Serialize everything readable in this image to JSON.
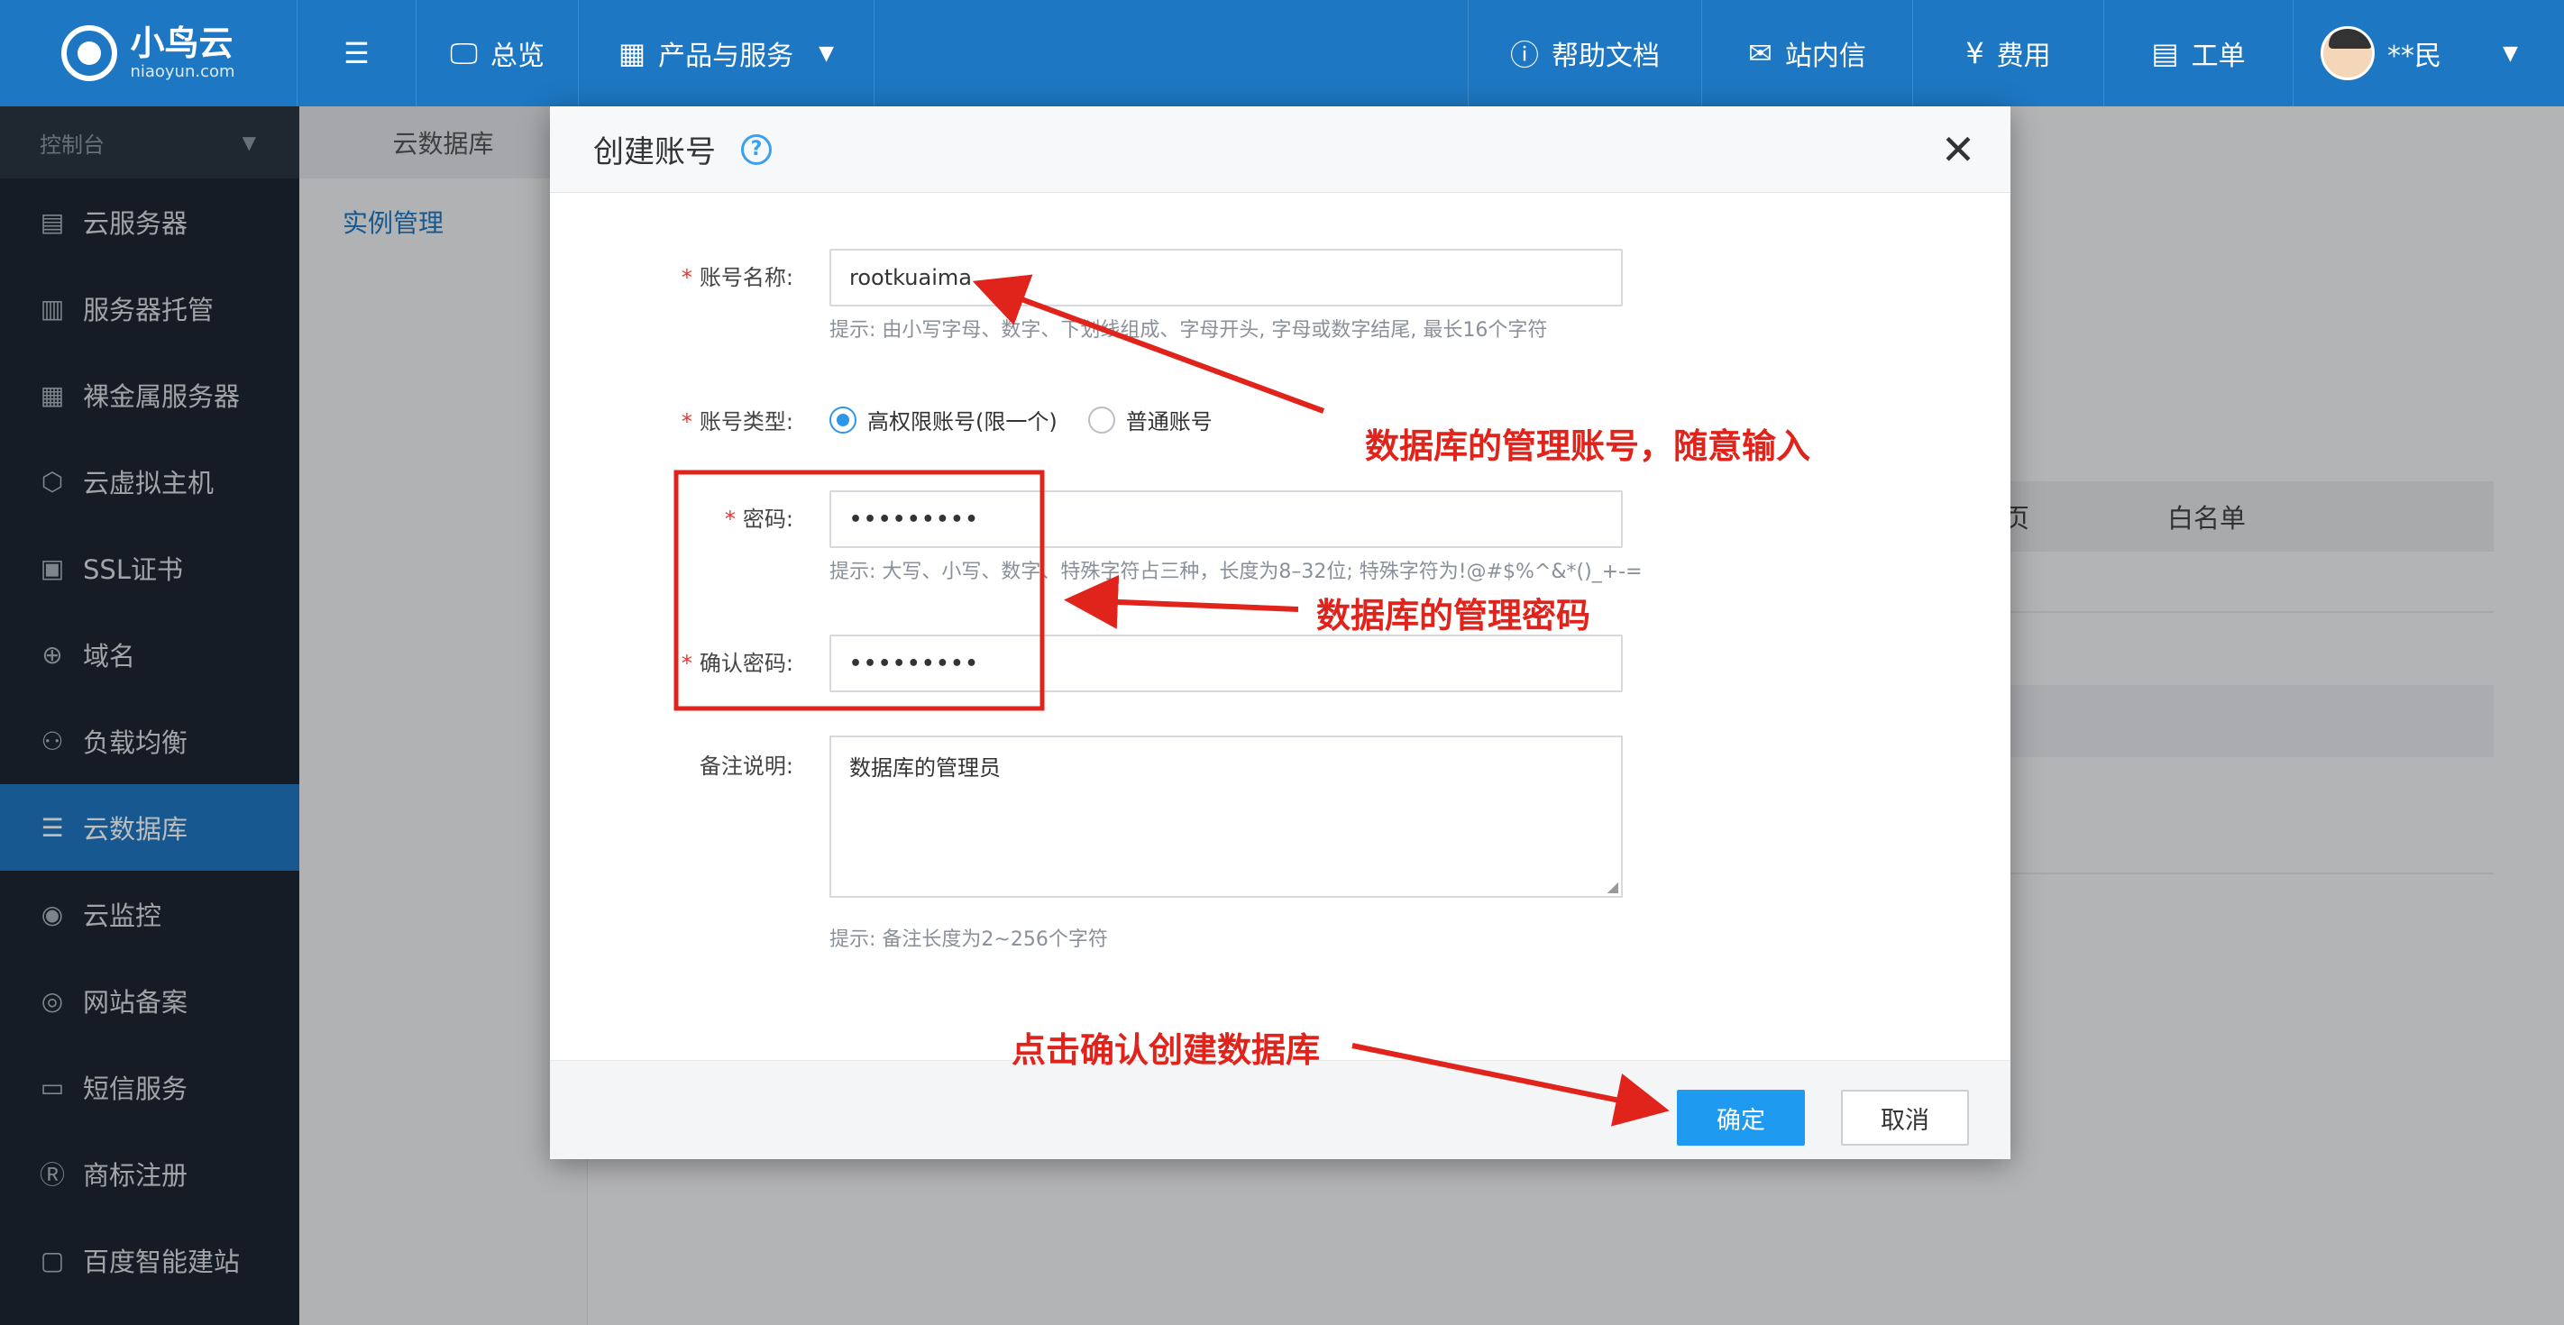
{
  "brand": {
    "name": "小鸟云",
    "sub": "niaoyun.com"
  },
  "topnav": {
    "menu_icon": "☰",
    "overview": "总览",
    "products": "产品与服务",
    "help_docs": "帮助文档",
    "messages": "站内信",
    "fees": "费用",
    "tickets": "工单",
    "user": "**民"
  },
  "sidebar": {
    "console": "控制台",
    "items": [
      {
        "label": "云服务器",
        "icon": "▤"
      },
      {
        "label": "服务器托管",
        "icon": "▥"
      },
      {
        "label": "裸金属服务器",
        "icon": "▦"
      },
      {
        "label": "云虚拟主机",
        "icon": "⬡"
      },
      {
        "label": "SSL证书",
        "icon": "▣"
      },
      {
        "label": "域名",
        "icon": "⊕"
      },
      {
        "label": "负载均衡",
        "icon": "⚇"
      },
      {
        "label": "云数据库",
        "icon": "☰"
      },
      {
        "label": "云监控",
        "icon": "◉"
      },
      {
        "label": "网站备案",
        "icon": "◎"
      },
      {
        "label": "短信服务",
        "icon": "▭"
      },
      {
        "label": "商标注册",
        "icon": "Ⓡ"
      },
      {
        "label": "百度智能建站",
        "icon": "▢"
      }
    ]
  },
  "subnav": {
    "title": "云数据库",
    "item": "实例管理"
  },
  "table": {
    "col_partial": "页",
    "col_whitelist": "白名单"
  },
  "modal": {
    "title": "创建账号",
    "help": "?",
    "close": "✕",
    "account_name": {
      "label": "账号名称:",
      "value": "rootkuaima",
      "hint": "提示: 由小写字母、数字、下划线组成、字母开头, 字母或数字结尾, 最长16个字符"
    },
    "account_type": {
      "label": "账号类型:",
      "option_high": "高权限账号(限一个)",
      "option_normal": "普通账号"
    },
    "password": {
      "label": "密码:",
      "value": "•••••••••",
      "hint": "提示: 大写、小写、数字、特殊字符占三种，长度为8–32位; 特殊字符为!@#$%^&*()_+-="
    },
    "confirm_password": {
      "label": "确认密码:",
      "value": "•••••••••"
    },
    "remark": {
      "label": "备注说明:",
      "value": "数据库的管理员",
      "hint": "提示: 备注长度为2~256个字符"
    },
    "ok": "确定",
    "cancel": "取消"
  },
  "annotations": {
    "account": "数据库的管理账号，随意输入",
    "password": "数据库的管理密码",
    "confirm": "点击确认创建数据库",
    "color": "#e0241c"
  }
}
